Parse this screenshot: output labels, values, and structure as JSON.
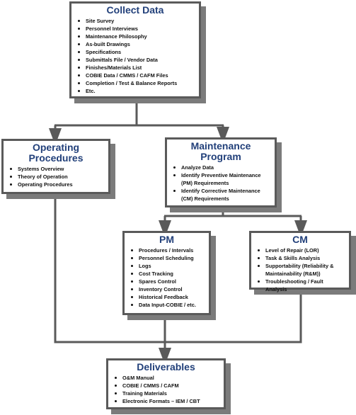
{
  "colors": {
    "border": "#5a5a5a",
    "shadow": "#7b7b7b",
    "title": "#22407a",
    "connector": "#5a5a5a"
  },
  "collect": {
    "title": "Collect Data",
    "items": [
      "Site Survey",
      "Personnel Interviews",
      "Maintenance Philosophy",
      "As-built Drawings",
      "Specifications",
      "Submittals File / Vendor Data",
      "Finishes/Materials List",
      "COBIE Data / CMMS / CAFM Files",
      "Completion / Test & Balance Reports",
      "Etc."
    ]
  },
  "operating": {
    "title": "Operating Procedures",
    "items": [
      "Systems Overview",
      "Theory of Operation",
      "Operating Procedures"
    ]
  },
  "maintenance": {
    "title": "Maintenance Program",
    "items": [
      "Analyze Data",
      "Identify Preventive Maintenance (PM) Requirements",
      "Identify Corrective Maintenance (CM) Requirements"
    ]
  },
  "pm": {
    "title": "PM",
    "items": [
      "Procedures / Intervals",
      "Personnel Scheduling",
      "Logs",
      "Cost Tracking",
      "Spares Control",
      "Inventory Control",
      "Historical Feedback",
      "Data Input-COBIE / etc."
    ]
  },
  "cm": {
    "title": "CM",
    "items": [
      "Level of Repair (LOR)",
      "Task & Skills Analysis",
      "Supportability (Reliability & Maintainability (R&M))",
      "Troubleshooting / Fault Analysis"
    ]
  },
  "deliverables": {
    "title": "Deliverables",
    "items": [
      "O&M Manual",
      "COBIE / CMMS / CAFM",
      "Training Materials",
      "Electronic Formats – IEM / CBT"
    ]
  }
}
